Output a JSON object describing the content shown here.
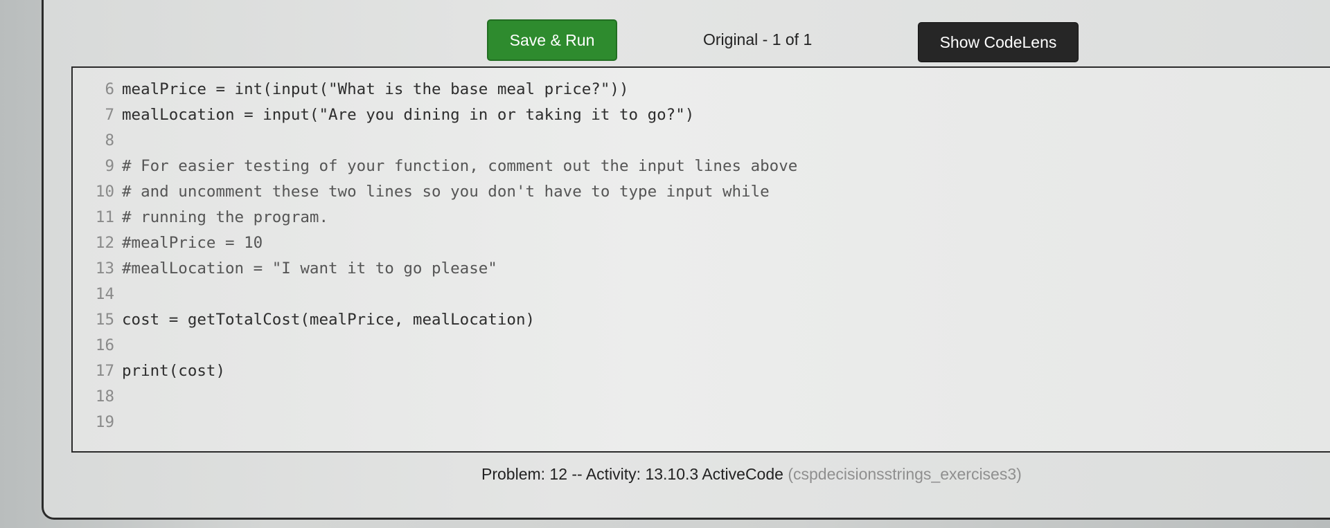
{
  "toolbar": {
    "run_label": "Save & Run",
    "version_label": "Original - 1 of 1",
    "codelens_label": "Show CodeLens"
  },
  "editor": {
    "lines": [
      {
        "num": "6",
        "text": "mealPrice = int(input(\"What is the base meal price?\"))"
      },
      {
        "num": "7",
        "text": "mealLocation = input(\"Are you dining in or taking it to go?\")"
      },
      {
        "num": "8",
        "text": ""
      },
      {
        "num": "9",
        "text": "# For easier testing of your function, comment out the input lines above"
      },
      {
        "num": "10",
        "text": "# and uncomment these two lines so you don't have to type input while"
      },
      {
        "num": "11",
        "text": "# running the program."
      },
      {
        "num": "12",
        "text": "#mealPrice = 10"
      },
      {
        "num": "13",
        "text": "#mealLocation = \"I want it to go please\""
      },
      {
        "num": "14",
        "text": ""
      },
      {
        "num": "15",
        "text": "cost = getTotalCost(mealPrice, mealLocation)"
      },
      {
        "num": "16",
        "text": ""
      },
      {
        "num": "17",
        "text": "print(cost)"
      },
      {
        "num": "18",
        "text": ""
      },
      {
        "num": "19",
        "text": ""
      }
    ]
  },
  "status": {
    "activity_text": "Problem: 12 -- Activity: 13.10.3 ActiveCode ",
    "activity_id": "(cspdecisionsstrings_exercises3)"
  },
  "colors": {
    "run_button": "#2e8b2e",
    "codelens_button": "#262626"
  }
}
